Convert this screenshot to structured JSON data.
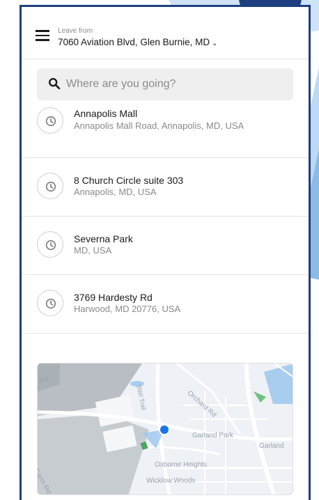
{
  "header": {
    "leave_label": "Leave from",
    "origin_address": "7060 Aviation Blvd, Glen Burnie, MD",
    "menu_icon": "hamburger-icon",
    "dropdown_icon": "chevron-down-icon"
  },
  "search": {
    "placeholder": "Where are you going?",
    "value": "",
    "icon": "search-icon"
  },
  "recent_destinations": [
    {
      "title": "Annapolis Mall",
      "subtitle": "Annapolis Mall Road, Annapolis, MD, USA",
      "icon": "clock-icon"
    },
    {
      "title": "8 Church Circle suite 303",
      "subtitle": "Annapolis, MD, USA",
      "icon": "clock-icon"
    },
    {
      "title": "Severna Park",
      "subtitle": "MD, USA",
      "icon": "clock-icon"
    },
    {
      "title": "3769 Hardesty Rd",
      "subtitle": "Harwood, MD 20776, USA",
      "icon": "clock-icon"
    }
  ],
  "map": {
    "labels": {
      "ark": "ark",
      "bwi_trail": "BWI Trail",
      "orchard_rd": "Orchard Rd",
      "garland_park": "Garland Park",
      "garland": "Garland",
      "osborne_heights": "Osborne Heights",
      "wicklow_woods": "Wicklow Woods",
      "farm_rd": "Farm Rd"
    },
    "location_marker_color": "#1a73e8"
  },
  "colors": {
    "frame_border": "#1d3f80",
    "divider": "#e4e4e4",
    "secondary_text": "#8a8a8a",
    "primary_text": "#1a1a1a",
    "search_bg": "#efefef"
  }
}
